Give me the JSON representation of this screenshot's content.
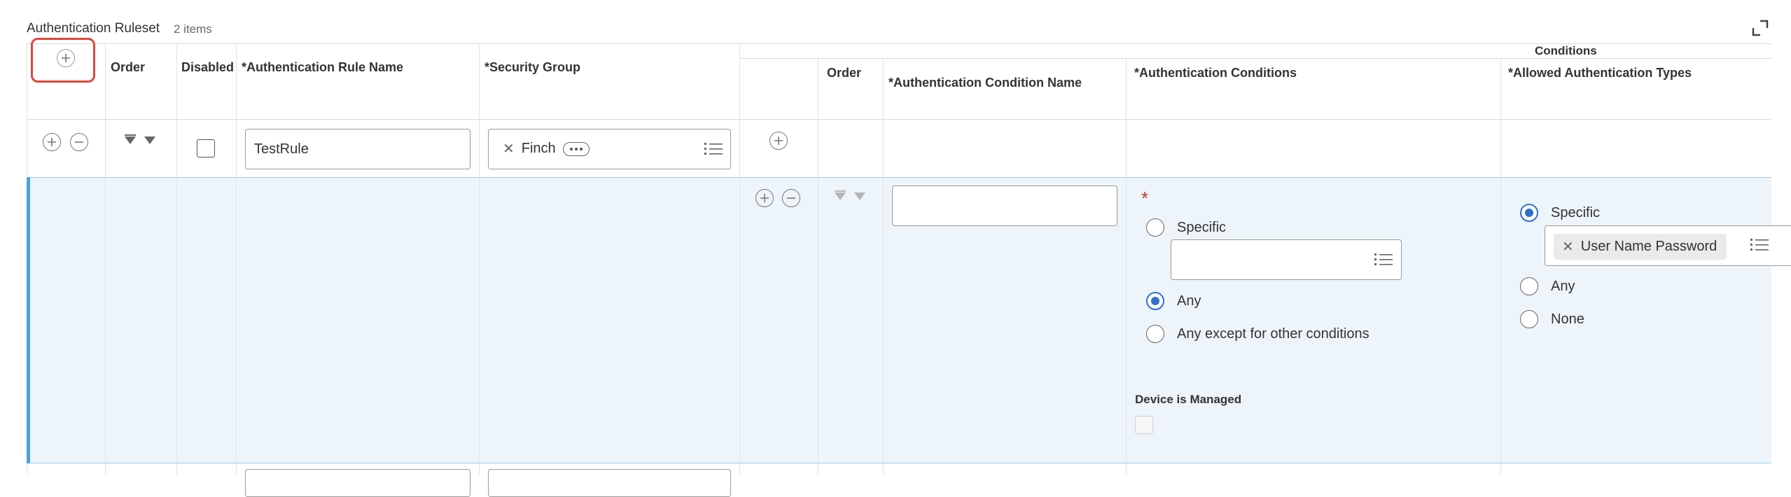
{
  "header": {
    "title": "Authentication Ruleset",
    "count": "2 items"
  },
  "columns": {
    "order": "Order",
    "disabled": "Disabled",
    "rule_name": "*Authentication Rule Name",
    "security_group": "*Security Group",
    "conditions_band": "Conditions",
    "cond_order": "Order",
    "cond_name": "*Authentication Condition Name",
    "auth_conditions": "*Authentication Conditions",
    "allowed_types": "*Allowed Authentication Types"
  },
  "row1": {
    "rule_name_value": "TestRule",
    "security_group_tag": "Finch"
  },
  "condition": {
    "required_marker": "*",
    "cond_name_value": "",
    "options": [
      "Specific",
      "Any",
      "Any except for other conditions"
    ],
    "selected": "Any",
    "device_managed_label": "Device is Managed"
  },
  "allowed": {
    "options": [
      "Specific",
      "Any",
      "None"
    ],
    "selected": "Specific",
    "tag": "User Name Password"
  },
  "colors": {
    "accent": "#2f6fce",
    "row_highlight": "#edf5fb",
    "row_border": "#4aa3df",
    "callout": "#e0463a"
  }
}
